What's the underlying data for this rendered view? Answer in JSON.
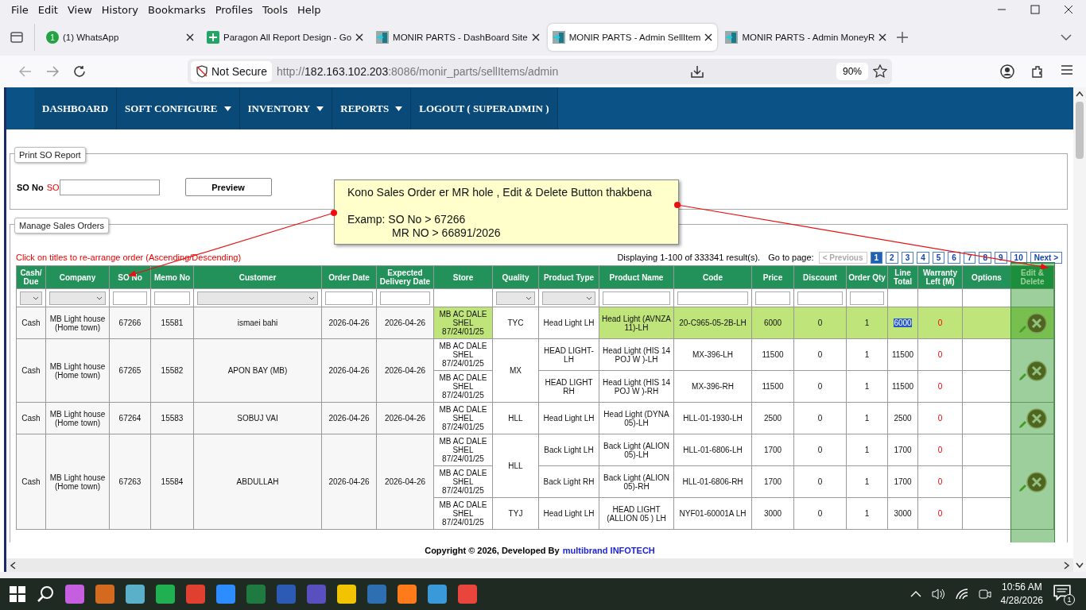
{
  "menu_bar": {
    "items": [
      "File",
      "Edit",
      "View",
      "History",
      "Bookmarks",
      "Profiles",
      "Tools",
      "Help"
    ]
  },
  "tabs": [
    {
      "title": "(1) WhatsApp",
      "badge": "1",
      "kind": "chat",
      "selected": false
    },
    {
      "title": "Paragon All Report Design - Go",
      "kind": "sheet",
      "selected": false
    },
    {
      "title": "MONIR PARTS - DashBoard Site",
      "kind": "door",
      "selected": false
    },
    {
      "title": "MONIR PARTS - Admin SellItem",
      "kind": "door",
      "selected": true
    },
    {
      "title": "MONIR PARTS - Admin MoneyR",
      "kind": "door",
      "selected": false
    }
  ],
  "address_bar": {
    "security": "Not Secure",
    "scheme": "http://",
    "host": "182.163.102.203",
    "path": ":8086/monir_parts/sellItems/admin",
    "zoom": "90%"
  },
  "nav": [
    {
      "label": "DASHBOARD",
      "dropdown": false
    },
    {
      "label": "SOFT CONFIGURE",
      "dropdown": true
    },
    {
      "label": "INVENTORY",
      "dropdown": true
    },
    {
      "label": "REPORTS",
      "dropdown": true
    },
    {
      "label": "LOGOUT ( SUPERADMIN )",
      "dropdown": false
    }
  ],
  "print_report": {
    "legend": "Print SO Report",
    "label": "SO No",
    "prefix": "SO",
    "button": "Preview"
  },
  "manage": {
    "legend": "Manage Sales Orders",
    "hint": "Click on titles to re-arrange order (Ascending/Descending)",
    "summary": "Displaying 1-100 of 333341 result(s).",
    "goto": "Go to page:",
    "pager": [
      {
        "label": "< Previous",
        "disabled": true,
        "selected": false
      },
      {
        "label": "1",
        "disabled": false,
        "selected": true
      },
      {
        "label": "2",
        "disabled": false,
        "selected": false
      },
      {
        "label": "3",
        "disabled": false,
        "selected": false
      },
      {
        "label": "4",
        "disabled": false,
        "selected": false
      },
      {
        "label": "5",
        "disabled": false,
        "selected": false
      },
      {
        "label": "6",
        "disabled": false,
        "selected": false
      },
      {
        "label": "7",
        "disabled": false,
        "selected": false
      },
      {
        "label": "8",
        "disabled": false,
        "selected": false
      },
      {
        "label": "9",
        "disabled": false,
        "selected": false
      },
      {
        "label": "10",
        "disabled": false,
        "selected": false
      },
      {
        "label": "Next >",
        "disabled": false,
        "selected": false
      }
    ]
  },
  "table": {
    "columns": [
      {
        "label": "Cash/ Due",
        "kind": "select"
      },
      {
        "label": "Company",
        "kind": "select"
      },
      {
        "label": "SO No",
        "kind": "text"
      },
      {
        "label": "Memo No",
        "kind": "text"
      },
      {
        "label": "Customer",
        "kind": "select"
      },
      {
        "label": "Order Date",
        "kind": "text"
      },
      {
        "label": "Expected Delivery Date",
        "kind": "text"
      },
      {
        "label": "Store",
        "kind": "plain"
      },
      {
        "label": "Quality",
        "kind": "select"
      },
      {
        "label": "Product Type",
        "kind": "select"
      },
      {
        "label": "Product Name",
        "kind": "text"
      },
      {
        "label": "Code",
        "kind": "text"
      },
      {
        "label": "Price",
        "kind": "text"
      },
      {
        "label": "Discount",
        "kind": "text"
      },
      {
        "label": "Order Qty",
        "kind": "text"
      },
      {
        "label": "Line Total",
        "kind": "plain"
      },
      {
        "label": "Warranty Left (M)",
        "kind": "plain"
      },
      {
        "label": "Options",
        "kind": "plain"
      },
      {
        "label": "Edit & Delete",
        "kind": "plain"
      }
    ],
    "orders": [
      {
        "payment": "Cash",
        "company": "MB Light house (Home town)",
        "so_no": "67266",
        "memo_no": "15581",
        "customer": "ismaei bahi",
        "order_date": "2026-04-26",
        "delivery_date": "2026-04-26",
        "highlighted": true,
        "groups": [
          {
            "quality": "TYC",
            "items": [
              {
                "store": "MB AC DALE SHEL 87/24/01/25",
                "type": "Head Light LH",
                "name": "Head Light (AVNZA 11)-LH",
                "code": "20-C965-05-2B-LH",
                "price": "6000",
                "discount": "0",
                "qty": "1",
                "total": "6000",
                "warranty": "0",
                "text_highlighted": true
              }
            ]
          }
        ]
      },
      {
        "payment": "Cash",
        "company": "MB Light house (Home town)",
        "so_no": "67265",
        "memo_no": "15582",
        "customer": "APON BAY (MB)",
        "order_date": "2026-04-26",
        "delivery_date": "2026-04-26",
        "highlighted": false,
        "groups": [
          {
            "quality": "MX",
            "items": [
              {
                "store": "MB AC DALE SHEL 87/24/01/25",
                "type": "HEAD LIGHT- LH",
                "name": "Head Light (HIS 14 POJ W )-LH",
                "code": "MX-396-LH",
                "price": "11500",
                "discount": "0",
                "qty": "1",
                "total": "11500",
                "warranty": "0",
                "text_highlighted": false
              },
              {
                "store": "MB AC DALE SHEL 87/24/01/25",
                "type": "HEAD LIGHT RH",
                "name": "Head Light (HIS 14 POJ W )-RH",
                "code": "MX-396-RH",
                "price": "11500",
                "discount": "0",
                "qty": "1",
                "total": "11500",
                "warranty": "0",
                "text_highlighted": false
              }
            ]
          }
        ]
      },
      {
        "payment": "Cash",
        "company": "MB Light house (Home town)",
        "so_no": "67264",
        "memo_no": "15583",
        "customer": "SOBUJ VAI",
        "order_date": "2026-04-26",
        "delivery_date": "2026-04-26",
        "highlighted": false,
        "groups": [
          {
            "quality": "HLL",
            "items": [
              {
                "store": "MB AC DALE SHEL 87/24/01/25",
                "type": "Head Light LH",
                "name": "Head Light (DYNA 05)-LH",
                "code": "HLL-01-1930-LH",
                "price": "2500",
                "discount": "0",
                "qty": "1",
                "total": "2500",
                "warranty": "0",
                "text_highlighted": false
              }
            ]
          }
        ]
      },
      {
        "payment": "Cash",
        "company": "MB Light house (Home town)",
        "so_no": "67263",
        "memo_no": "15584",
        "customer": "ABDULLAH",
        "order_date": "2026-04-26",
        "delivery_date": "2026-04-26",
        "highlighted": false,
        "groups": [
          {
            "quality": "HLL",
            "items": [
              {
                "store": "MB AC DALE SHEL 87/24/01/25",
                "type": "Back Light LH",
                "name": "Back Light (ALION 05)-LH",
                "code": "HLL-01-6806-LH",
                "price": "1700",
                "discount": "0",
                "qty": "1",
                "total": "1700",
                "warranty": "0",
                "text_highlighted": false
              },
              {
                "store": "MB AC DALE SHEL 87/24/01/25",
                "type": "Back Light RH",
                "name": "Back Light (ALION 05)-RH",
                "code": "HLL-01-6806-RH",
                "price": "1700",
                "discount": "0",
                "qty": "1",
                "total": "1700",
                "warranty": "0",
                "text_highlighted": false
              }
            ]
          },
          {
            "quality": "TYJ",
            "items": [
              {
                "store": "MB AC DALE SHEL 87/24/01/25",
                "type": "Head Light LH",
                "name": "HEAD LIGHT (ALLION 05 ) LH",
                "code": "NYF01-60001A LH",
                "price": "3000",
                "discount": "0",
                "qty": "1",
                "total": "3000",
                "warranty": "0",
                "text_highlighted": false
              }
            ]
          }
        ]
      }
    ]
  },
  "footer": {
    "text": "Copyright © 2026, Developed By",
    "link": "multibrand INFOTECH"
  },
  "callout": {
    "lines": [
      {
        "text": "Kono Sales Order er MR hole , Edit & Delete Button thakbena",
        "indent": false
      },
      {
        "text": "Examp: SO No > 67266",
        "indent": false
      },
      {
        "text": "MR NO > 66891/2026",
        "indent": true
      }
    ]
  },
  "tray": {
    "time": "10:56 AM",
    "date": "4/28/2026",
    "notifications": "1"
  }
}
